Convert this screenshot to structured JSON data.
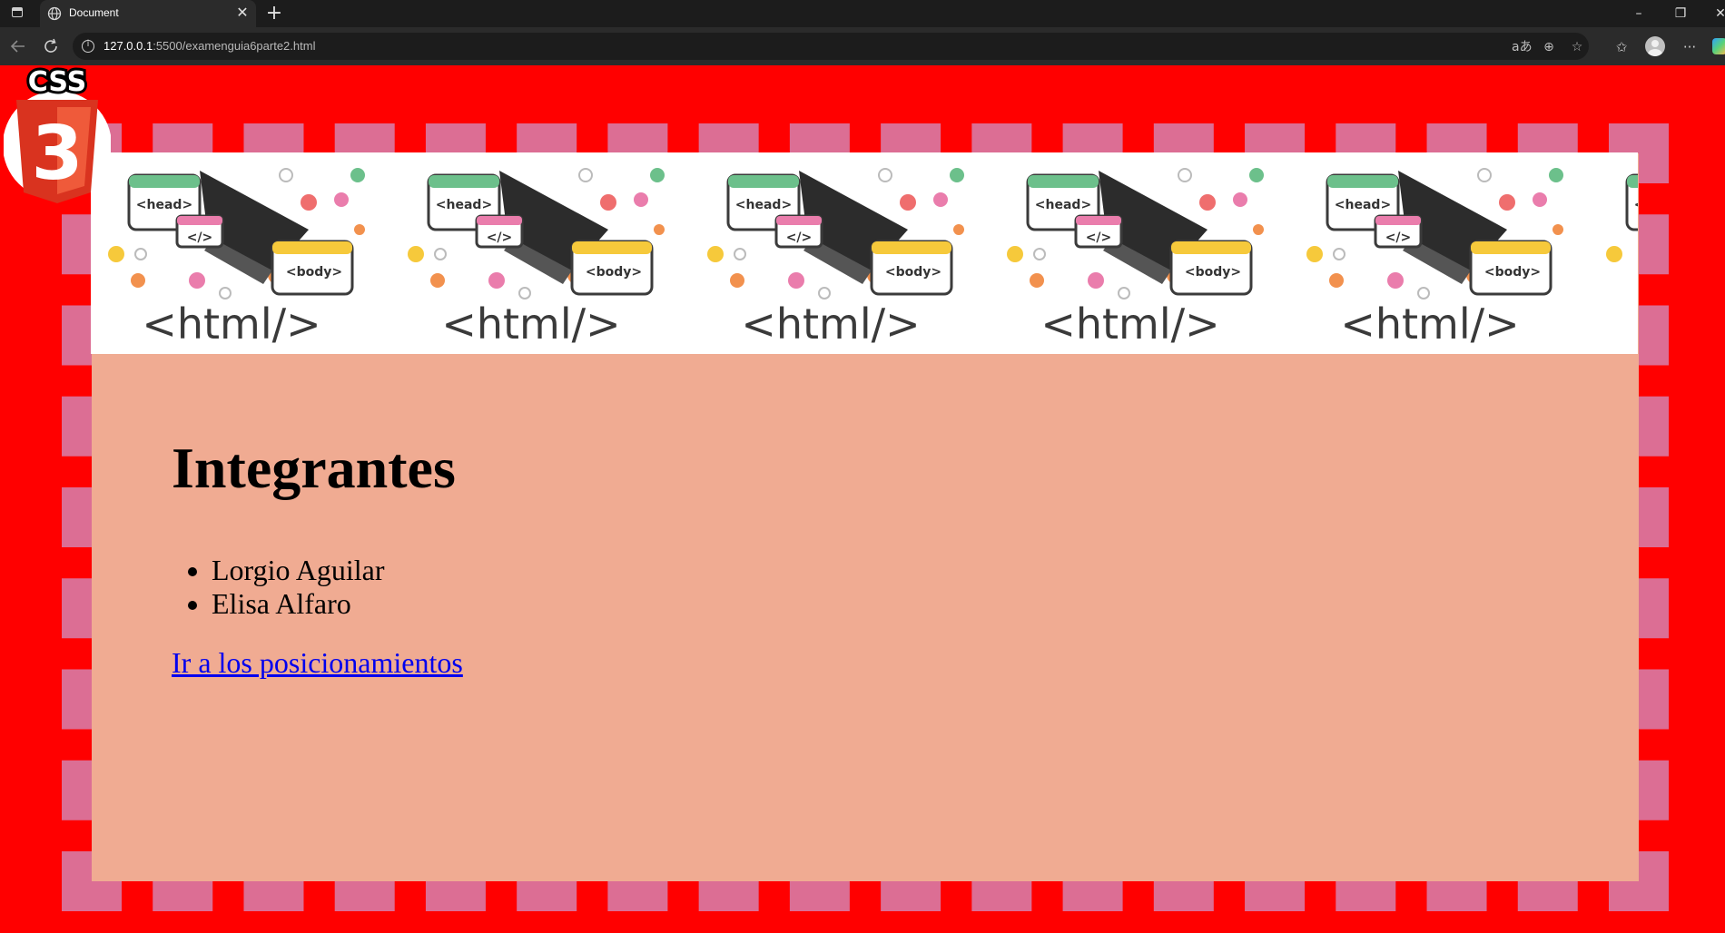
{
  "browser": {
    "tab_title": "Document",
    "url_host": "127.0.0.1",
    "url_rest": ":5500/examenguia6parte2.html",
    "colors": {
      "tabbar": "#1c1c1c",
      "toolbar": "#2b2b2b"
    }
  },
  "page": {
    "background_color": "#ff0000",
    "box_color": "#f0ab92",
    "border_color": "#dc6e94",
    "heading": "Integrantes",
    "members": [
      "Lorgio Aguilar",
      "Elisa Alfaro"
    ],
    "link_text": "Ir a los posicionamientos",
    "logo_text": "CSS",
    "logo_number": "3",
    "banner_texts": {
      "head": "<head>",
      "code": "</>",
      "body": "<body>",
      "html": "<html/>"
    }
  }
}
